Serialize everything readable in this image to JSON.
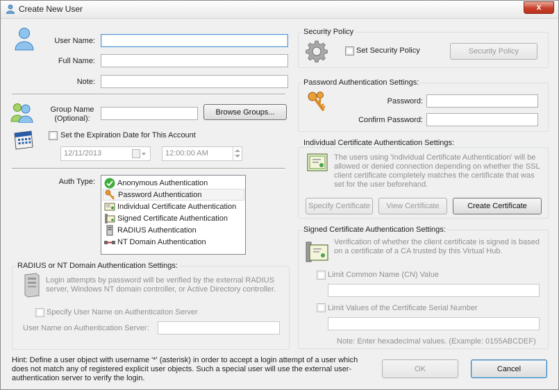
{
  "window": {
    "title": "Create New User",
    "close_glyph": "x"
  },
  "user": {
    "username_label": "User Name:",
    "username_value": "",
    "fullname_label": "Full Name:",
    "fullname_value": "",
    "note_label": "Note:",
    "note_value": ""
  },
  "group": {
    "label_line1": "Group Name",
    "label_line2": "(Optional):",
    "value": "",
    "browse_button": "Browse Groups..."
  },
  "expiration": {
    "checkbox_label": "Set the Expiration Date for This Account",
    "date_value": "12/11/2013",
    "time_value": "12:00:00 AM"
  },
  "auth": {
    "label": "Auth Type:",
    "items": [
      {
        "label": "Anonymous Authentication",
        "icon": "check-icon"
      },
      {
        "label": "Password Authentication",
        "icon": "keys-icon"
      },
      {
        "label": "Individual Certificate Authentication",
        "icon": "certificate-icon"
      },
      {
        "label": "Signed Certificate Authentication",
        "icon": "signed-certificate-icon"
      },
      {
        "label": "RADIUS Authentication",
        "icon": "server-icon"
      },
      {
        "label": "NT Domain Authentication",
        "icon": "network-icon"
      }
    ],
    "selected_index": 1
  },
  "radius": {
    "title": "RADIUS or NT Domain Authentication Settings:",
    "description": "Login attempts by password will be verified by the external RADIUS server, Windows NT domain controller, or Active Directory controller.",
    "specify_checkbox": "Specify User Name on Authentication Server",
    "username_label": "User Name on Authentication Server:",
    "username_value": ""
  },
  "security": {
    "title": "Security Policy",
    "checkbox_label": "Set Security Policy",
    "button": "Security Policy"
  },
  "password": {
    "title": "Password Authentication Settings:",
    "password_label": "Password:",
    "password_value": "",
    "confirm_label": "Confirm Password:",
    "confirm_value": ""
  },
  "individual_cert": {
    "title": "Individual Certificate Authentication Settings:",
    "description": "The users using 'Individual Certificate Authentication' will be allowed or denied connection depending on whether the SSL client certificate completely matches the certificate that was set for the user beforehand.",
    "specify_button": "Specify Certificate",
    "view_button": "View Certificate",
    "create_button": "Create Certificate"
  },
  "signed_cert": {
    "title": "Signed Certificate Authentication Settings:",
    "description": "Verification of whether the client certificate is signed is based on a certificate of a CA trusted by this Virtual Hub.",
    "cn_checkbox": "Limit Common Name (CN) Value",
    "cn_value": "",
    "serial_checkbox": "Limit Values of the Certificate Serial Number",
    "serial_value": "",
    "note": "Note: Enter hexadecimal values. (Example: 0155ABCDEF)"
  },
  "hint": "Hint: Define a user object with username '*' (asterisk) in order to accept a login attempt of a user which does not match any of registered explicit user objects. Such a special user will use the external user-authentication server to verify the login.",
  "buttons": {
    "ok": "OK",
    "cancel": "Cancel"
  }
}
